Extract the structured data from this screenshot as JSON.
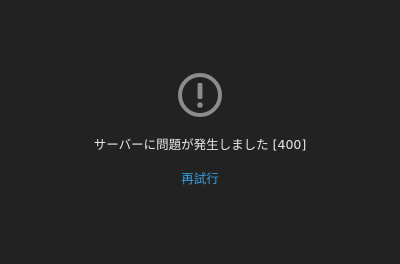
{
  "error_panel": {
    "icon": "exclamation-circle-icon",
    "icon_color": "#8c8c8c",
    "message": "サーバーに問題が発生しました [400]",
    "retry_label": "再試行",
    "link_color": "#3a9bdc",
    "background_color": "#222222"
  }
}
